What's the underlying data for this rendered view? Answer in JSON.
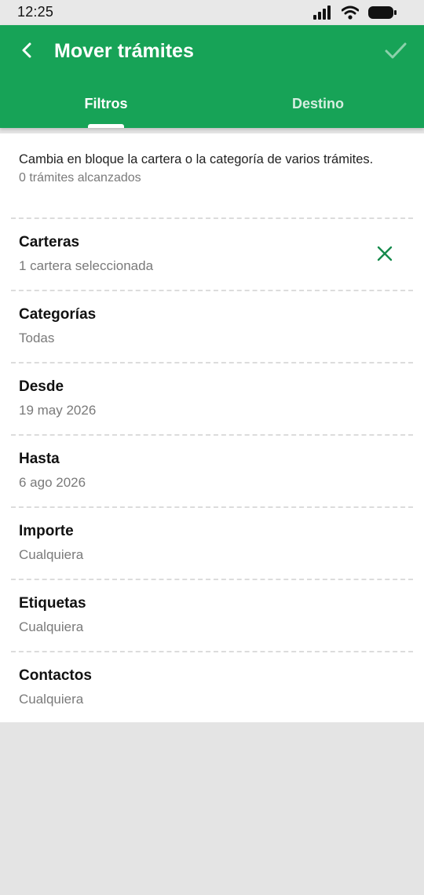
{
  "status_bar": {
    "time": "12:25",
    "icons": [
      "signal-icon",
      "wifi-icon",
      "battery-icon"
    ]
  },
  "app_bar": {
    "back_icon": "chevron-left-icon",
    "title": "Mover trámites",
    "confirm_icon": "check-icon",
    "color": "#17a357"
  },
  "tabs": [
    {
      "label": "Filtros",
      "selected": true
    },
    {
      "label": "Destino",
      "selected": false
    }
  ],
  "intro": {
    "text": "Cambia en bloque la cartera o la categoría de varios trámites.",
    "count": "0 trámites alcanzados"
  },
  "filters": [
    {
      "title": "Carteras",
      "value": "1 cartera seleccionada",
      "clearable": true
    },
    {
      "title": "Categorías",
      "value": "Todas"
    },
    {
      "title": "Desde",
      "value": "19 may 2026"
    },
    {
      "title": "Hasta",
      "value": "6 ago 2026"
    },
    {
      "title": "Importe",
      "value": "Cualquiera"
    },
    {
      "title": "Etiquetas",
      "value": "Cualquiera"
    },
    {
      "title": "Contactos",
      "value": "Cualquiera"
    }
  ],
  "colors": {
    "accent": "#17a357",
    "clear_icon": "#168a4c",
    "background": "#e4e4e4"
  }
}
